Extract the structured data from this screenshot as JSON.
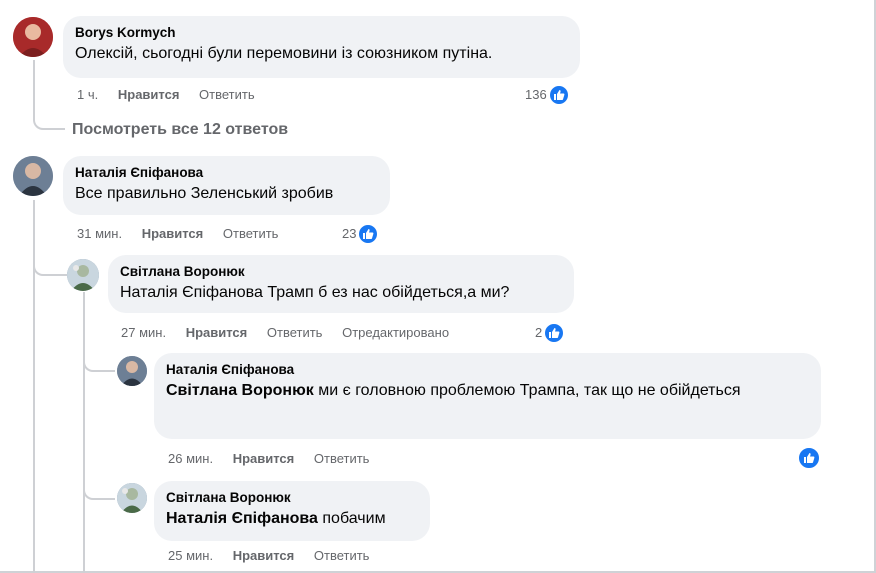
{
  "comments": [
    {
      "author": "Borys Kormych",
      "text": "Олексій, сьогодні були перемовини із союзником путіна.",
      "time": "1 ч.",
      "like": "Нравится",
      "reply": "Ответить",
      "reactions": "136"
    },
    {
      "author": "Наталія Єпіфанова",
      "text": "Все правильно Зеленський зробив",
      "time": "31 мин.",
      "like": "Нравится",
      "reply": "Ответить",
      "reactions": "23"
    },
    {
      "author": "Світлана Воронюк",
      "text": "Наталія Єпіфанова Трамп б ез нас обійдеться,а ми?",
      "time": "27 мин.",
      "like": "Нравится",
      "reply": "Ответить",
      "edited": "Отредактировано",
      "reactions": "2"
    },
    {
      "author": "Наталія Єпіфанова",
      "mention": "Світлана Воронюк",
      "text": " ми є головною проблемою Трампа, так що не обійдеться",
      "time": "26 мин.",
      "like": "Нравится",
      "reply": "Ответить"
    },
    {
      "author": "Світлана Воронюк",
      "mention": "Наталія Єпіфанова",
      "text": " побачим",
      "time": "25 мин.",
      "like": "Нравится",
      "reply": "Ответить"
    }
  ],
  "view_all_replies": "Посмотреть все 12 ответов",
  "colors": {
    "accent": "#1877f2",
    "bubble": "#f0f2f5",
    "meta": "#65676b"
  },
  "icons": {
    "reaction": "like-thumb-icon"
  }
}
